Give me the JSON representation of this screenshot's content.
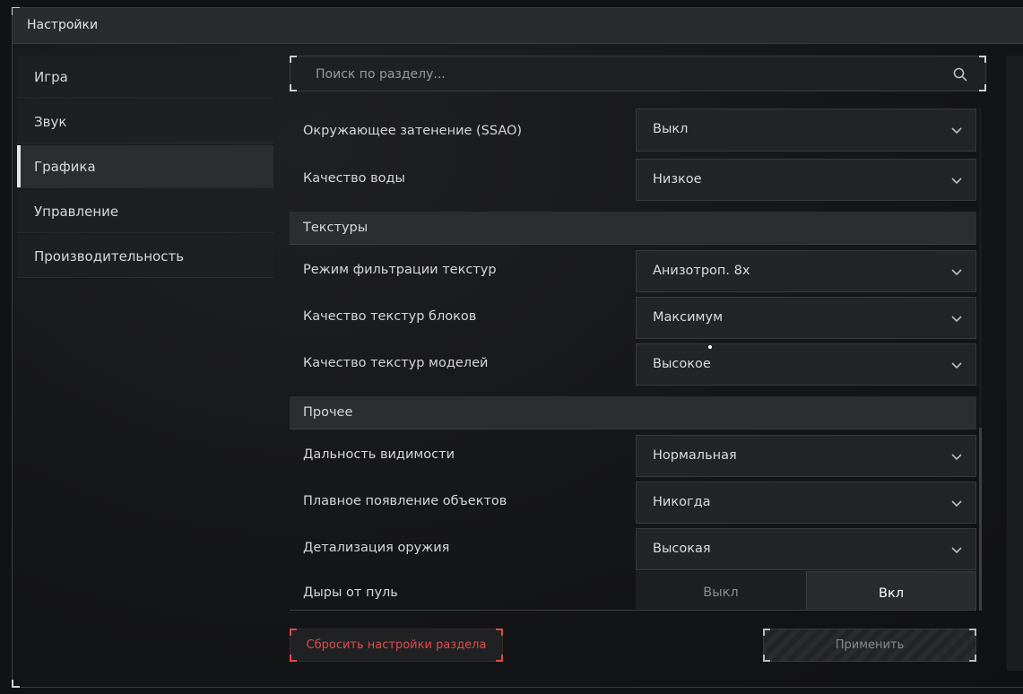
{
  "window": {
    "title": "Настройки"
  },
  "sidebar": {
    "items": [
      {
        "label": "Игра",
        "active": false
      },
      {
        "label": "Звук",
        "active": false
      },
      {
        "label": "Графика",
        "active": true
      },
      {
        "label": "Управление",
        "active": false
      },
      {
        "label": "Производительность",
        "active": false
      }
    ]
  },
  "search": {
    "placeholder": "Поиск по разделу...",
    "value": "",
    "icon": "search-icon"
  },
  "settings": {
    "ssao": {
      "label": "Окружающее затенение (SSAO)",
      "value": "Выкл"
    },
    "water": {
      "label": "Качество воды",
      "value": "Низкое"
    },
    "textures_section": "Текстуры",
    "texture_filter": {
      "label": "Режим фильтрации текстур",
      "value": "Анизотроп. 8x"
    },
    "block_textures": {
      "label": "Качество текстур блоков",
      "value": "Максимум"
    },
    "model_textures": {
      "label": "Качество текстур моделей",
      "value": "Высокое"
    },
    "other_section": "Прочее",
    "view_distance": {
      "label": "Дальность видимости",
      "value": "Нормальная"
    },
    "object_fade": {
      "label": "Плавное появление объектов",
      "value": "Никогда"
    },
    "weapon_detail": {
      "label": "Детализация оружия",
      "value": "Высокая"
    },
    "bullet_holes": {
      "label": "Дыры от пуль",
      "off": "Выкл",
      "on": "Вкл",
      "selected": "Вкл"
    }
  },
  "buttons": {
    "reset": "Сбросить настройки раздела",
    "apply": "Применить"
  },
  "colors": {
    "accent_reset": "#e04a4a",
    "background": "#111214"
  }
}
